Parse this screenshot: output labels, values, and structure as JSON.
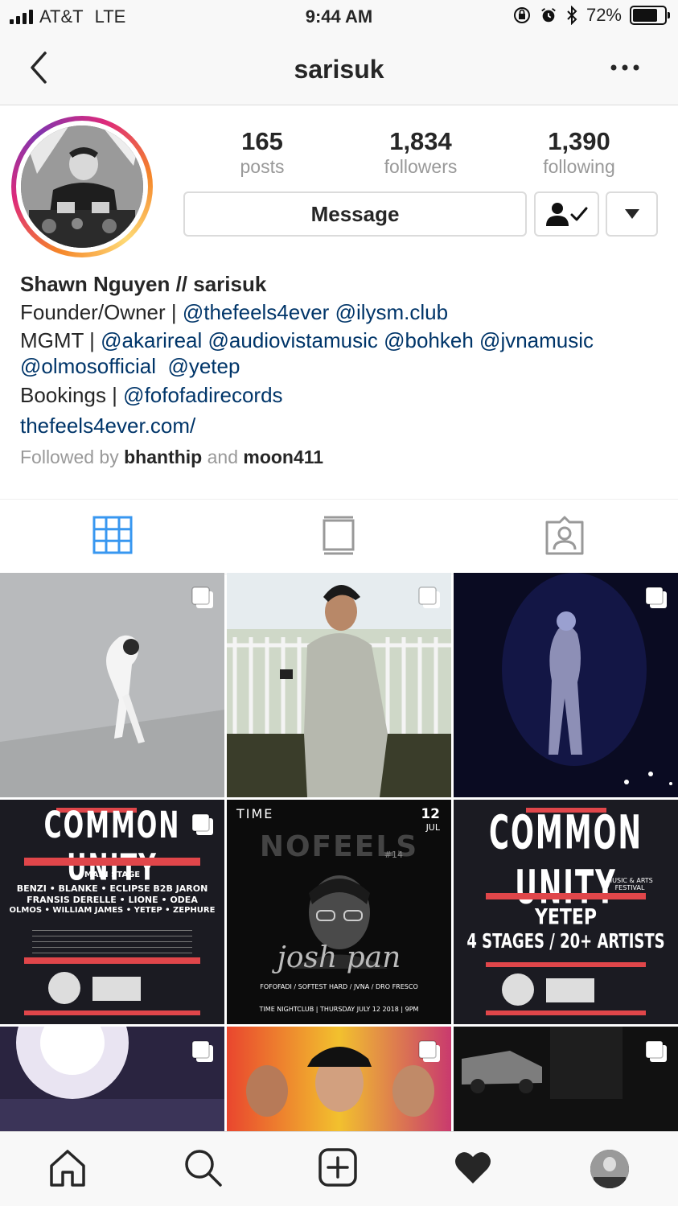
{
  "status_bar": {
    "carrier": "AT&T",
    "network": "LTE",
    "time": "9:44 AM",
    "battery": "72%"
  },
  "header": {
    "title": "sarisuk",
    "back_icon": "chevron-left-icon",
    "more_icon": "more-horizontal-icon"
  },
  "profile": {
    "stats": [
      {
        "value": "165",
        "label": "posts"
      },
      {
        "value": "1,834",
        "label": "followers"
      },
      {
        "value": "1,390",
        "label": "following"
      }
    ],
    "message_button": "Message",
    "following_icon": "person-check-icon",
    "dropdown_icon": "triangle-down-icon"
  },
  "bio": {
    "name": "Shawn Nguyen // sarisuk",
    "line1_prefix": "Founder/Owner | ",
    "line1_mentions": [
      "@thefeels4ever",
      "@ilysm.club"
    ],
    "line2_prefix": "MGMT | ",
    "line2_mentions": [
      "@akarireal",
      "@audiovistamusic",
      "@bohkeh",
      "@jvnamusic"
    ],
    "line3_mentions": [
      "@olmosofficial",
      "@yetep"
    ],
    "line4_prefix": "Bookings | ",
    "line4_mention": "@fofofadirecords",
    "website": "thefeels4ever.com/",
    "followed_by_prefix": "Followed by ",
    "followed_by_user1": "bhanthip",
    "followed_by_and": " and ",
    "followed_by_user2": "moon411"
  },
  "tabs": [
    {
      "name": "grid",
      "icon": "grid-icon",
      "active": true
    },
    {
      "name": "feed",
      "icon": "feed-icon",
      "active": false
    },
    {
      "name": "tagged",
      "icon": "tagged-icon",
      "active": false
    }
  ],
  "posts": {
    "poster1": {
      "header": "COMMON UNITY",
      "main_stage": "MAIN STAGE",
      "lineup1": "BENZI • BLANKE • ECLIPSE B2B JARON",
      "lineup2": "FRANSIS DERELLE • LIONE • ODEA",
      "lineup3": "OLMOS • WILLIAM JAMES • YETEP • ZEPHURE"
    },
    "poster2": {
      "venue": "TIME",
      "date_day": "12",
      "date_month": "JUL",
      "title": "NOFEELS",
      "issue": "#14",
      "artist": "josh pan",
      "support": "FOFOFADI / SOFTEST HARD / JVNA / DRO FRESCO",
      "footer": "TIME NIGHTCLUB | THURSDAY JULY 12 2018 | 9PM"
    },
    "poster3": {
      "header": "COMMON UNITY",
      "subtitle": "MUSIC & ARTS FESTIVAL",
      "headliner": "YETEP",
      "tagline": "4 STAGES / 20+ ARTISTS"
    }
  },
  "bottom_nav": [
    {
      "name": "home",
      "icon": "home-icon"
    },
    {
      "name": "search",
      "icon": "search-icon"
    },
    {
      "name": "add",
      "icon": "plus-square-icon"
    },
    {
      "name": "activity",
      "icon": "heart-icon"
    },
    {
      "name": "profile",
      "icon": "avatar-icon"
    }
  ],
  "colors": {
    "link": "#003569",
    "active_tab": "#3897f0",
    "poster_red": "#e0464a"
  }
}
